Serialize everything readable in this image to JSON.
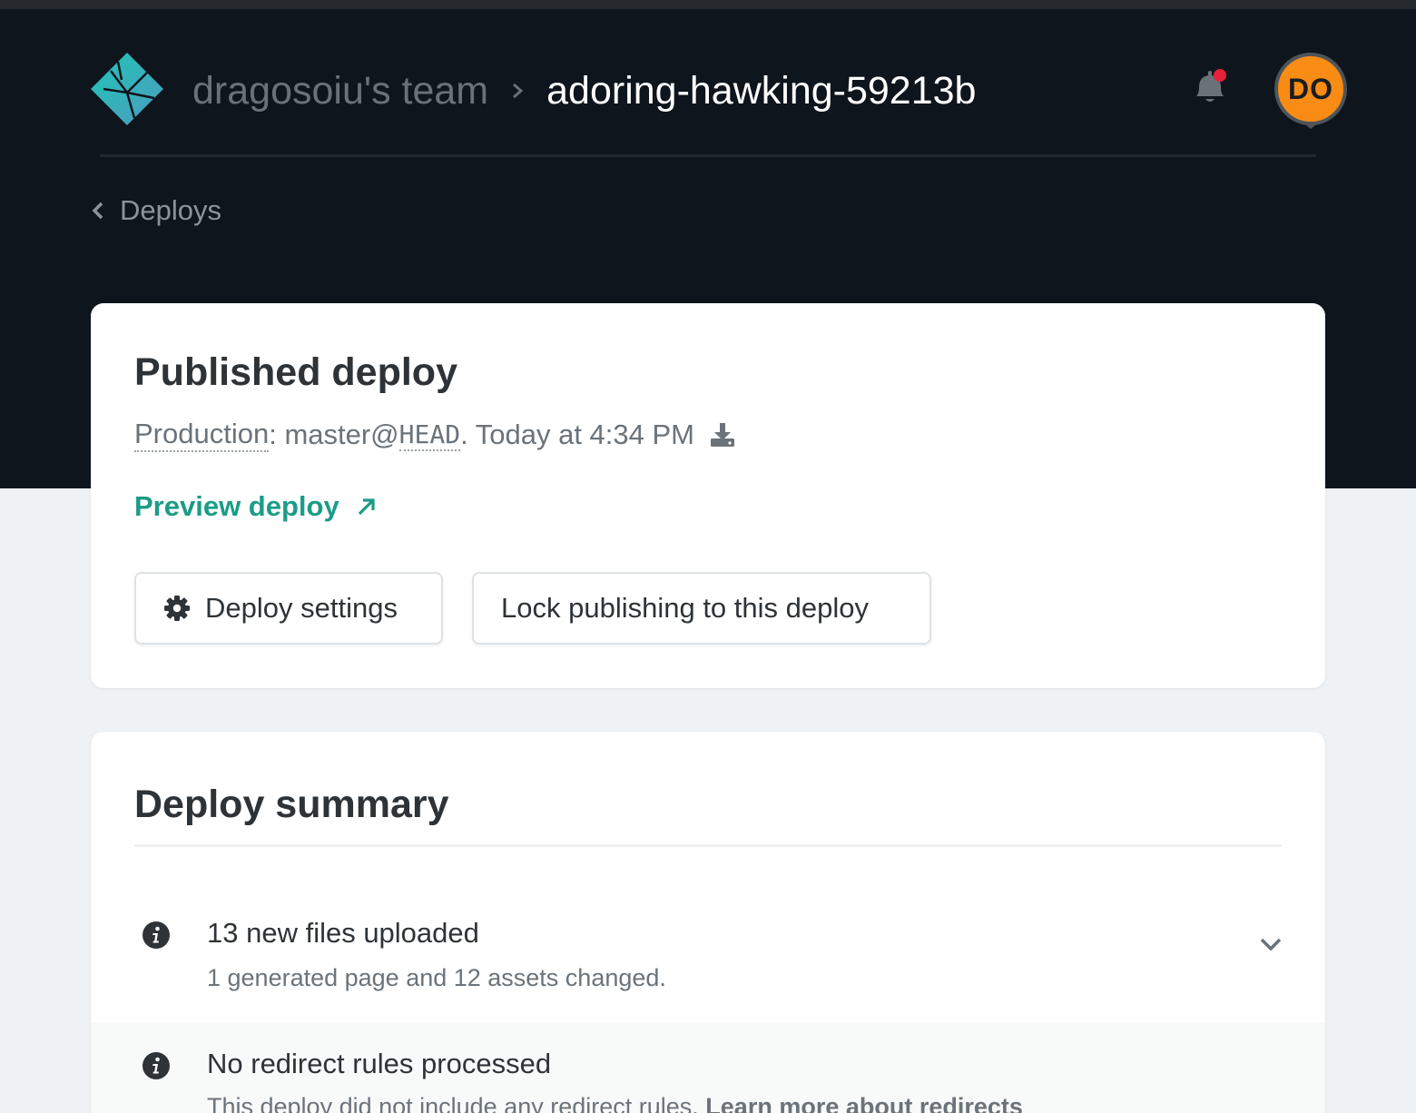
{
  "header": {
    "team_name": "dragosoiu's team",
    "site_name": "adoring-hawking-59213b",
    "avatar_initials": "DO",
    "back_label": "Deploys",
    "notification_dot_color": "#e8203a"
  },
  "published": {
    "title": "Published deploy",
    "context_label": "Production",
    "branch_text": ": master@",
    "commit_ref": "HEAD",
    "time_text": ". Today at 4:34 PM",
    "preview_label": "Preview deploy",
    "settings_button": "Deploy settings",
    "lock_button": "Lock publishing to this deploy"
  },
  "summary": {
    "title": "Deploy summary",
    "items": [
      {
        "title": "13 new files uploaded",
        "description": "1 generated page and 12 assets changed."
      },
      {
        "title": "No redirect rules processed",
        "description": "This deploy did not include any redirect rules. ",
        "link": "Learn more about redirects"
      }
    ]
  },
  "colors": {
    "header_bg": "#0e151c",
    "accent_teal": "#1b9c86",
    "avatar_orange": "#f88c14",
    "page_bg": "#eef2f5"
  }
}
